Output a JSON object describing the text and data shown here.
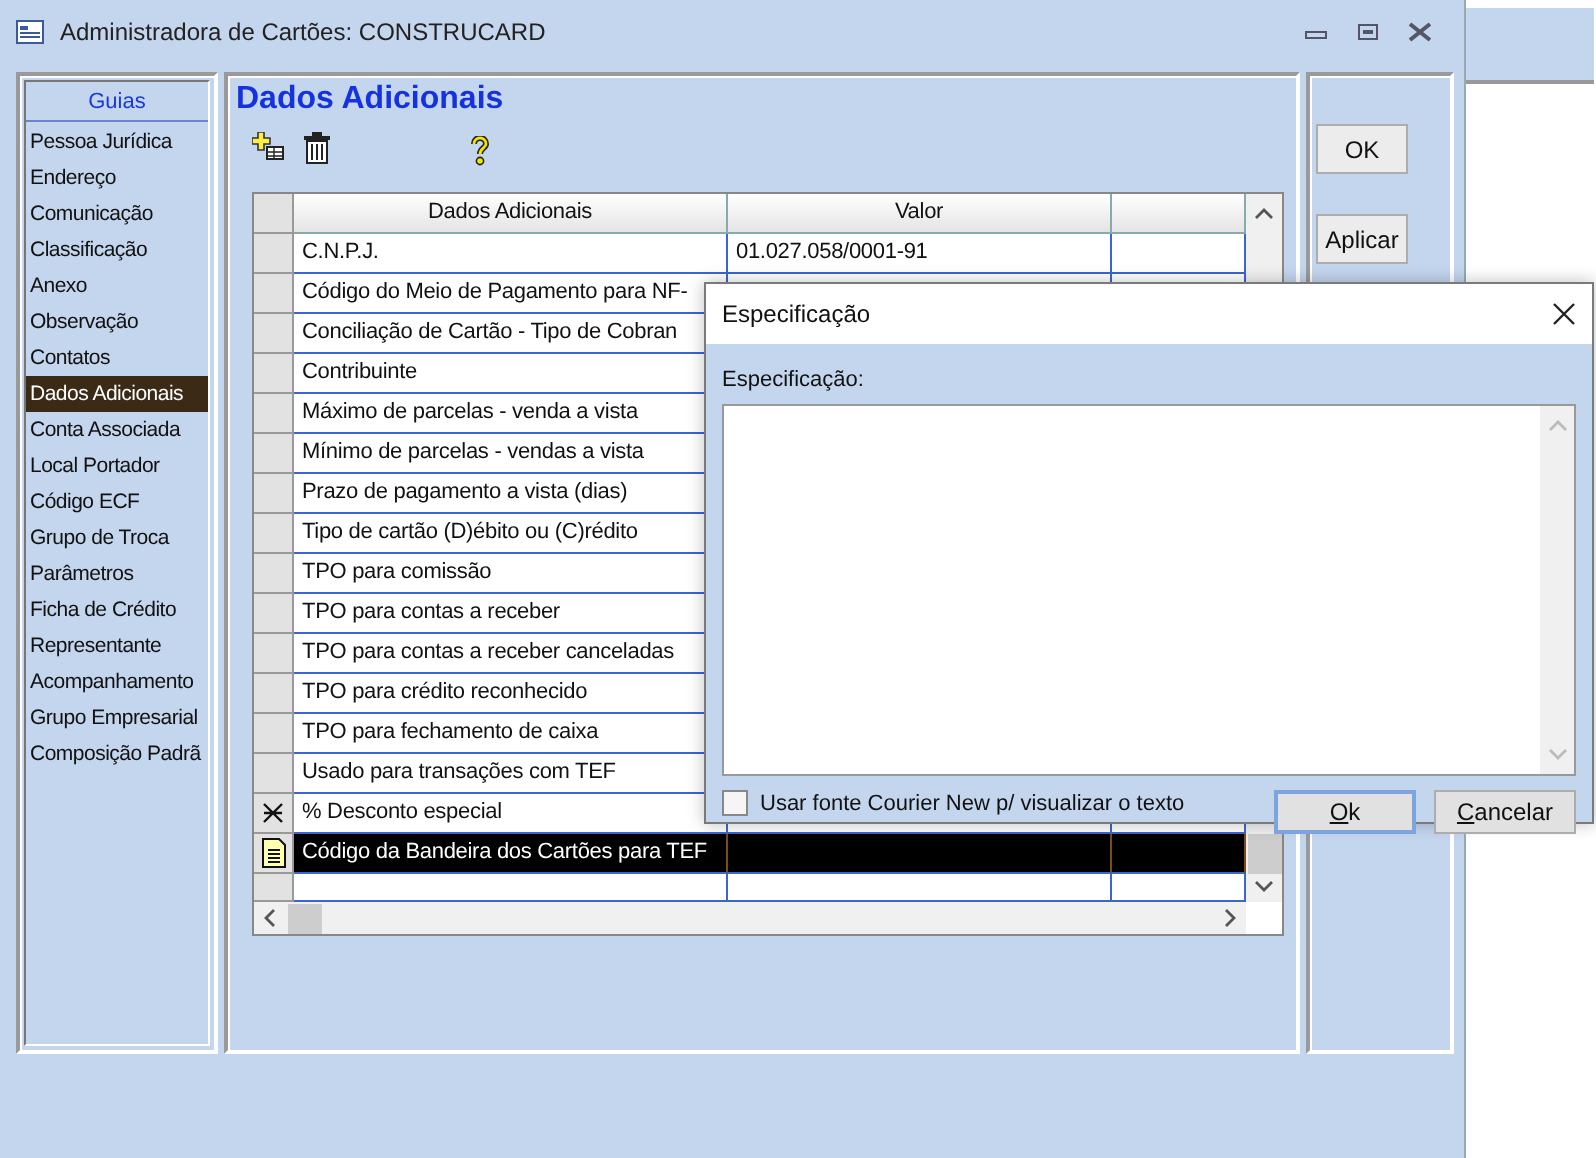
{
  "window": {
    "title": "Administradora de Cartões: CONSTRUCARD"
  },
  "sidebar": {
    "header": "Guias",
    "items": [
      {
        "label": "Pessoa Jurídica",
        "selected": false
      },
      {
        "label": "Endereço",
        "selected": false
      },
      {
        "label": "Comunicação",
        "selected": false
      },
      {
        "label": "Classificação",
        "selected": false
      },
      {
        "label": "Anexo",
        "selected": false
      },
      {
        "label": "Observação",
        "selected": false
      },
      {
        "label": "Contatos",
        "selected": false
      },
      {
        "label": "Dados Adicionais",
        "selected": true
      },
      {
        "label": "Conta Associada",
        "selected": false
      },
      {
        "label": "Local Portador",
        "selected": false
      },
      {
        "label": "Código ECF",
        "selected": false
      },
      {
        "label": "Grupo de Troca",
        "selected": false
      },
      {
        "label": "Parâmetros",
        "selected": false
      },
      {
        "label": "Ficha de Crédito",
        "selected": false
      },
      {
        "label": "Representante",
        "selected": false
      },
      {
        "label": "Acompanhamento",
        "selected": false
      },
      {
        "label": "Grupo Empresarial",
        "selected": false
      },
      {
        "label": "Composição Padrã",
        "selected": false
      }
    ]
  },
  "content": {
    "title": "Dados Adicionais"
  },
  "table": {
    "columns": [
      "Dados Adicionais",
      "Valor"
    ],
    "rows": [
      {
        "name": "C.N.P.J.",
        "value": "01.027.058/0001-91",
        "selected": false
      },
      {
        "name": "Código do Meio de Pagamento para NF-",
        "selected": false
      },
      {
        "name": "Conciliação de Cartão - Tipo de Cobran",
        "selected": false
      },
      {
        "name": "Contribuinte",
        "selected": false
      },
      {
        "name": "Máximo de parcelas - venda a vista",
        "selected": false
      },
      {
        "name": "Mínimo de parcelas - vendas a vista",
        "selected": false
      },
      {
        "name": "Prazo de pagamento a vista (dias)",
        "selected": false
      },
      {
        "name": "Tipo de cartão (D)ébito ou (C)rédito",
        "selected": false
      },
      {
        "name": "TPO para comissão",
        "selected": false
      },
      {
        "name": "TPO para contas a receber",
        "selected": false
      },
      {
        "name": "TPO para contas a receber canceladas",
        "selected": false
      },
      {
        "name": "TPO para crédito reconhecido",
        "selected": false
      },
      {
        "name": "TPO para fechamento de caixa",
        "selected": false
      },
      {
        "name": "Usado para transações com TEF",
        "selected": false
      },
      {
        "name": "% Desconto especial",
        "kind": "cross",
        "selected": false
      },
      {
        "name": "Código da Bandeira dos Cartões para TEF",
        "kind": "document",
        "selected": true
      }
    ]
  },
  "side_buttons": [
    "OK",
    "Aplicar"
  ],
  "dialog": {
    "title": "Especificação",
    "label": "Especificação:",
    "checkbox": {
      "label": "Usar fonte Courier New p/ visualizar o texto",
      "checked": false
    },
    "buttons": [
      "Ok",
      "Cancelar"
    ]
  }
}
